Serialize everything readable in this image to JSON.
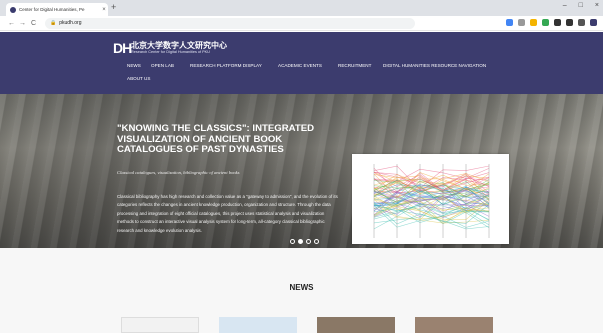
{
  "browser": {
    "tab_title": "Center for Digital Humanities, Pe",
    "tab_close": "×",
    "new_tab": "+",
    "url": "pkudh.org",
    "lock": "🔒",
    "nav_back": "←",
    "nav_forward": "→",
    "nav_reload": "C",
    "win_min": "–",
    "win_max": "□",
    "win_close": "×",
    "extension_colors": [
      "#4285f4",
      "#999999",
      "#f4b400",
      "#34a853",
      "#333333",
      "#333333",
      "#555555",
      "#3c3c6e"
    ]
  },
  "header": {
    "logo_mark": "DH",
    "org_name_cn": "北京大学数字人文研究中心",
    "org_name_en": "Research Center for Digital Humanities of PKU",
    "bg_color": "#3c3c6e",
    "nav": [
      {
        "label": "NEWS",
        "name": "nav-news"
      },
      {
        "label": "OPEN LAB",
        "name": "nav-open-lab"
      },
      {
        "label": "RESEARCH PLATFORM DISPLAY",
        "name": "nav-research-platform"
      },
      {
        "label": "ACADEMIC EVENTS",
        "name": "nav-academic-events"
      },
      {
        "label": "RECRUITMENT",
        "name": "nav-recruitment"
      },
      {
        "label": "DIGITAL HUMANITIES RESOURCE NAVIGATION",
        "name": "nav-resource-navigation"
      },
      {
        "label": "ABOUT US",
        "name": "nav-about-us"
      }
    ]
  },
  "hero": {
    "title": "\"KNOWING THE CLASSICS\": INTEGRATED VISUALIZATION OF ANCIENT BOOK CATALOGUES OF PAST DYNASTIES",
    "subtitle": "Classical catalogues, visualization, bibliographic of ancient books",
    "description": "Classical bibliography has high research and collection value as a \"gateway to admission\", and the evolution of its categories reflects the changes in ancient knowledge production, organization and structure. Through the data processing and integration of eight official catalogues, this project uses statistical analysis and visualization methods to construct an interactive visual analysis system for long-term, all-category classical bibliographic research and knowledge evolution analysis.",
    "slides_total": 4,
    "slide_active": 1,
    "chart_palette": [
      "#e4507a",
      "#f0a030",
      "#58b858",
      "#3aa0d8",
      "#8c60c8",
      "#d8c040",
      "#40c0b0"
    ]
  },
  "news": {
    "heading": "NEWS"
  }
}
